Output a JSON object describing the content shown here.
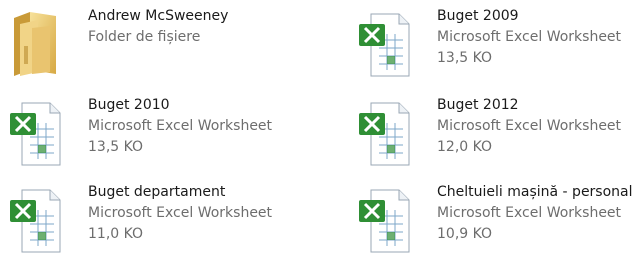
{
  "items": [
    {
      "name": "Andrew McSweeney",
      "type": "Folder de fișiere",
      "size": "",
      "icon": "folder-icon"
    },
    {
      "name": "Buget 2009",
      "type": "Microsoft Excel Worksheet",
      "size": "13,5 KO",
      "icon": "excel-file-icon"
    },
    {
      "name": "Buget 2010",
      "type": "Microsoft Excel Worksheet",
      "size": "13,5 KO",
      "icon": "excel-file-icon"
    },
    {
      "name": "Buget 2012",
      "type": "Microsoft Excel Worksheet",
      "size": "12,0 KO",
      "icon": "excel-file-icon"
    },
    {
      "name": "Buget departament",
      "type": "Microsoft Excel Worksheet",
      "size": "11,0 KO",
      "icon": "excel-file-icon"
    },
    {
      "name": "Cheltuieli mașină - personal",
      "type": "Microsoft Excel Worksheet",
      "size": "10,9 KO",
      "icon": "excel-file-icon"
    }
  ]
}
